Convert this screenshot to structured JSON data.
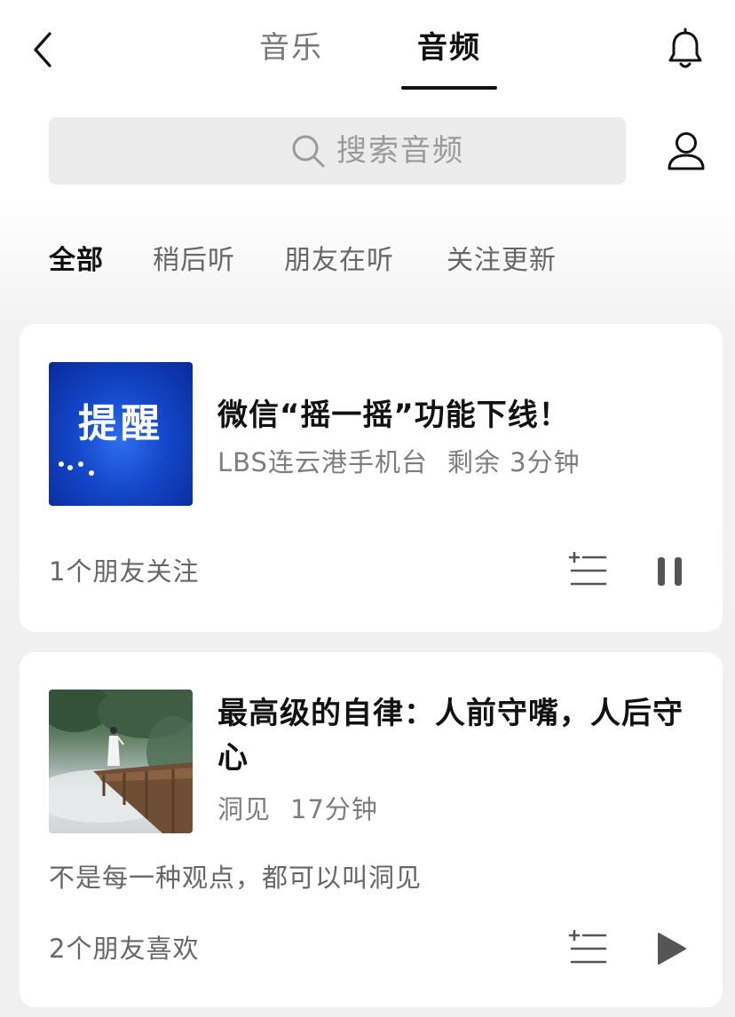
{
  "header": {
    "tabs": [
      {
        "label": "音乐",
        "active": false
      },
      {
        "label": "音频",
        "active": true
      }
    ]
  },
  "search": {
    "placeholder": "搜索音频"
  },
  "filters": [
    {
      "label": "全部",
      "active": true
    },
    {
      "label": "稍后听",
      "active": false
    },
    {
      "label": "朋友在听",
      "active": false
    },
    {
      "label": "关注更新",
      "active": false
    }
  ],
  "feed": [
    {
      "cover_text": "提醒",
      "title": "微信“摇一摇”功能下线！",
      "source": "LBS连云港手机台",
      "duration": "剩余 3分钟",
      "social": "1个朋友关注",
      "state": "playing",
      "play_icon": "pause-icon"
    },
    {
      "title": "最高级的自律：人前守嘴，人后守心",
      "source": "洞见",
      "duration": "17分钟",
      "description": "不是每一种观点，都可以叫洞见",
      "social": "2个朋友喜欢",
      "state": "paused",
      "play_icon": "play-icon"
    }
  ],
  "colors": {
    "text_primary": "#111111",
    "text_secondary": "#7d7d7d",
    "search_bg": "#ebebeb",
    "cover_blue": "#1447c9"
  }
}
